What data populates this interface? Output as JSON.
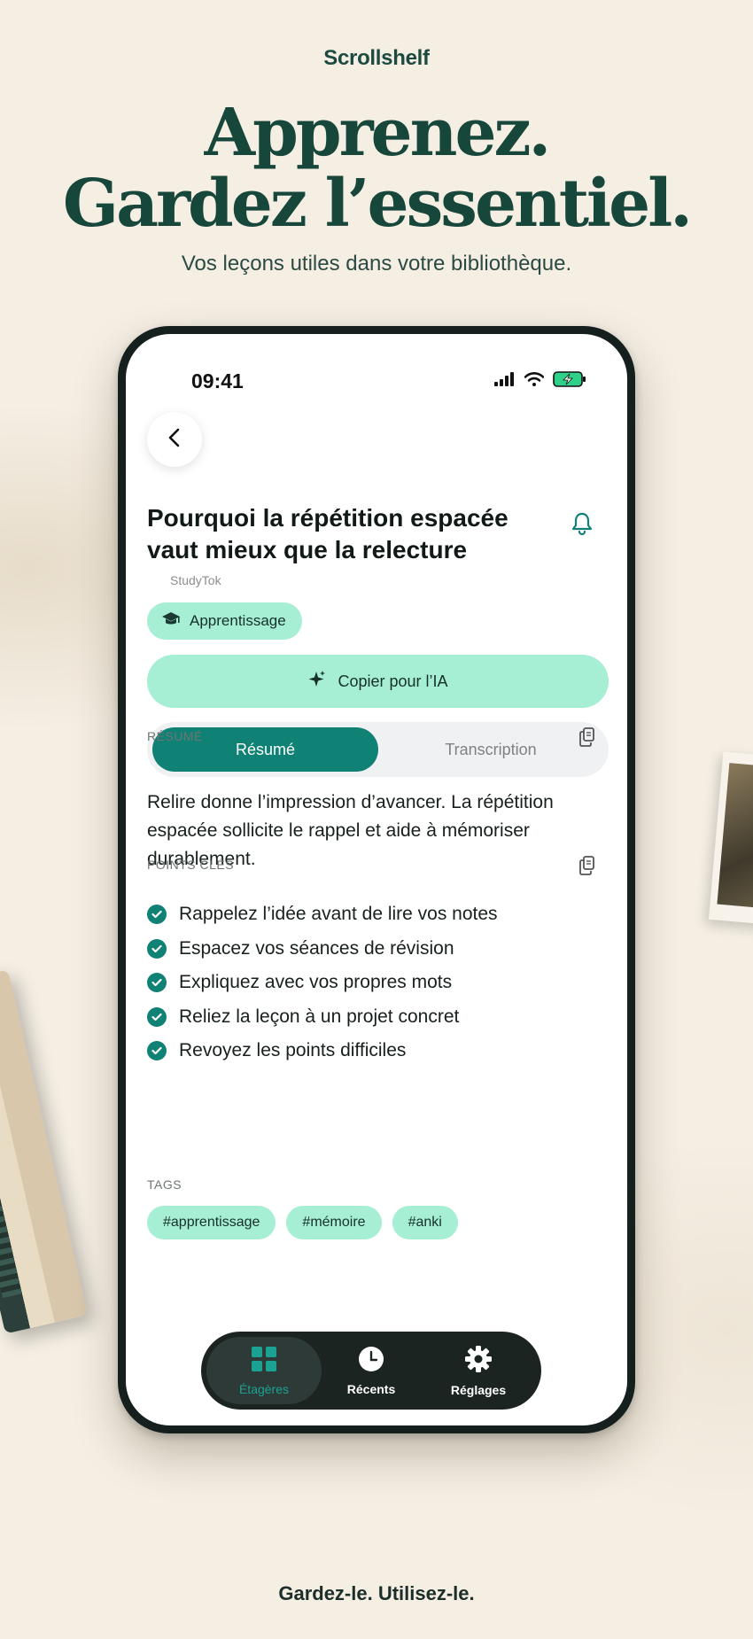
{
  "brand": "Scrollshelf",
  "headline": {
    "line1": "Apprenez.",
    "line2": "Gardez l’essentiel."
  },
  "subtitle": "Vos leçons utiles dans votre bibliothèque.",
  "footer_tagline": "Gardez-le. Utilisez-le.",
  "phone": {
    "status_bar": {
      "time": "09:41",
      "icons": [
        "signal-icon",
        "wifi-icon",
        "battery-charging-icon"
      ]
    },
    "back_icon": "chevron-left-icon",
    "video": {
      "title": "Pourquoi la répétition espacée vaut mieux que la relecture",
      "source": "StudyTok",
      "reminder_icon": "bell-icon",
      "category": {
        "label": "Apprentissage",
        "icon": "graduation-cap-icon"
      }
    },
    "copy_ai_button": {
      "label": "Copier pour l’IA",
      "icon": "sparkle-icon"
    },
    "segmented": {
      "active": "Résumé",
      "inactive": "Transcription"
    },
    "summary": {
      "label": "RÉSUMÉ",
      "text": "Relire donne l’impression d’avancer. La répétition espacée sollicite le rappel et aide à mémoriser durablement."
    },
    "key_points": {
      "label": "POINTS CLÉS",
      "items": [
        "Rappelez l’idée avant de lire vos notes",
        "Espacez vos séances de révision",
        "Expliquez avec vos propres mots",
        "Reliez la leçon à un projet concret",
        "Revoyez les points difficiles"
      ]
    },
    "tags": {
      "label": "TAGS",
      "items": [
        "#apprentissage",
        "#mémoire",
        "#anki"
      ]
    },
    "tabbar": {
      "items": [
        {
          "label": "Étagères",
          "icon": "grid-icon",
          "active": true
        },
        {
          "label": "Récents",
          "icon": "clock-icon",
          "active": false
        },
        {
          "label": "Réglages",
          "icon": "gear-icon",
          "active": false
        }
      ]
    }
  },
  "colors": {
    "background": "#f4eee3",
    "brand_green": "#17463b",
    "accent_teal": "#0f8175",
    "mint": "#a6efd4",
    "tabbar": "#1c2422"
  }
}
